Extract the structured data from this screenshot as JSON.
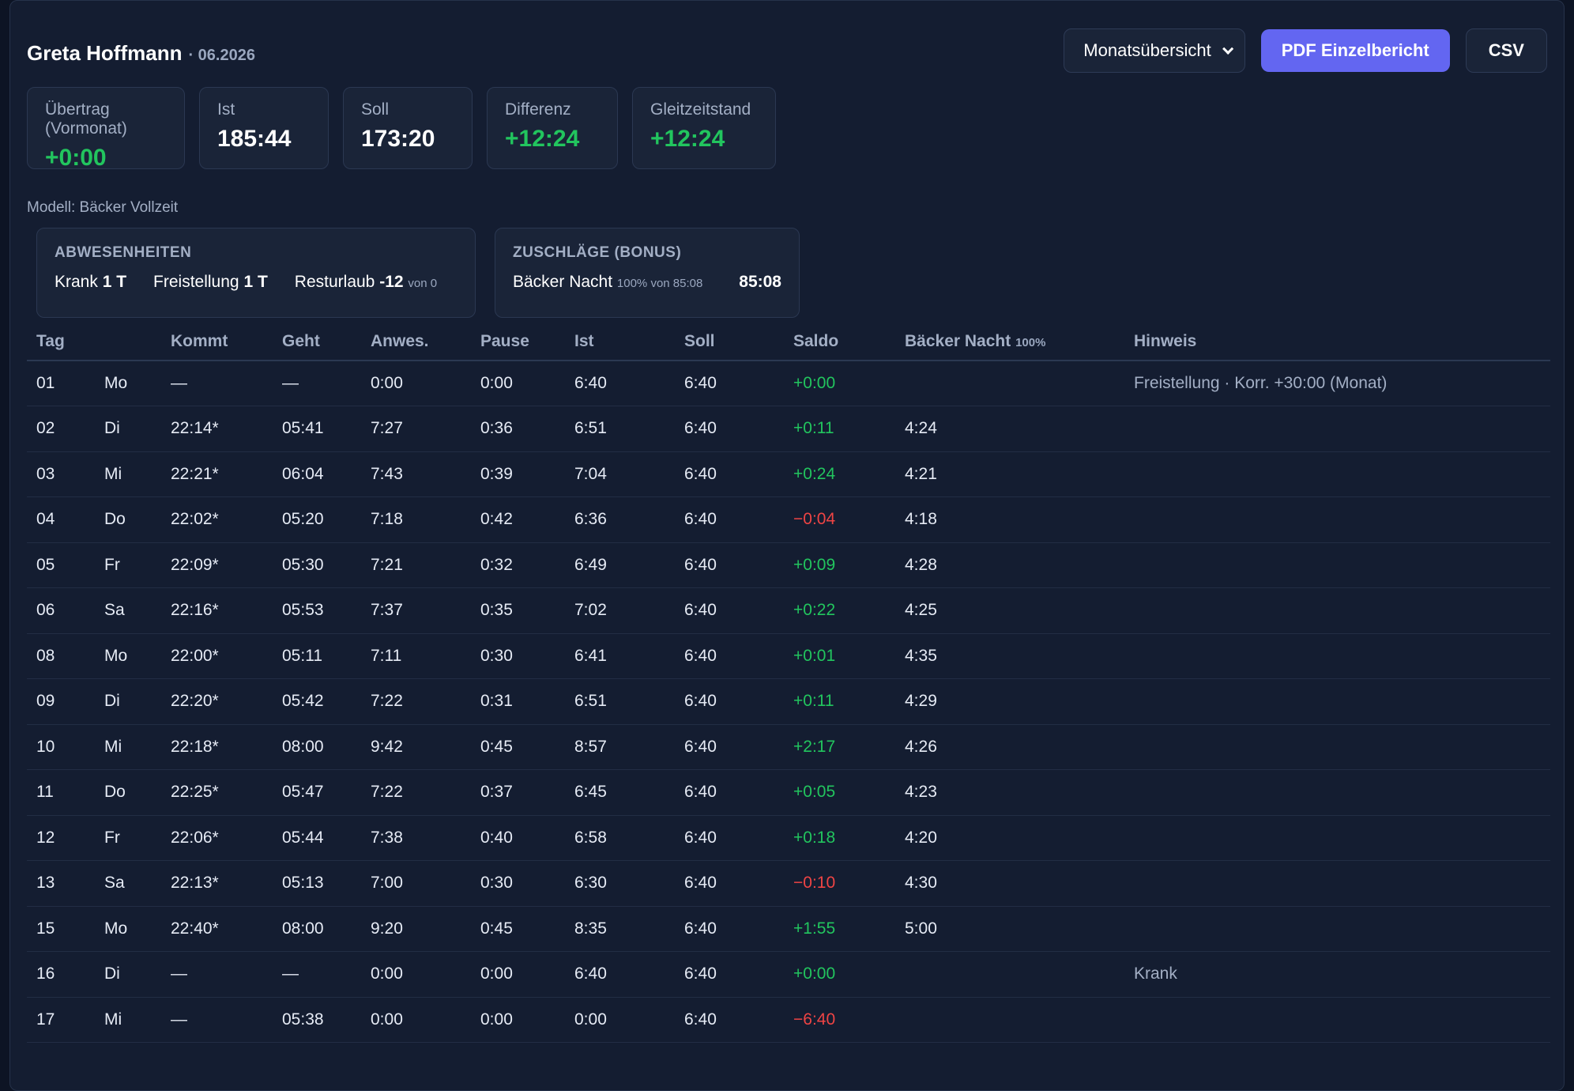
{
  "header": {
    "name": "Greta Hoffmann",
    "period": "· 06.2026"
  },
  "actions": {
    "view_select": "Monatsübersicht",
    "pdf_label": "PDF Einzelbericht",
    "csv_label": "CSV"
  },
  "stats": [
    {
      "label": "Übertrag (Vormonat)",
      "value": "+0:00",
      "tone": "pos"
    },
    {
      "label": "Ist",
      "value": "185:44",
      "tone": ""
    },
    {
      "label": "Soll",
      "value": "173:20",
      "tone": ""
    },
    {
      "label": "Differenz",
      "value": "+12:24",
      "tone": "pos"
    },
    {
      "label": "Gleitzeitstand",
      "value": "+12:24",
      "tone": "pos"
    }
  ],
  "model": "Modell: Bäcker Vollzeit",
  "absences": {
    "title": "ABWESENHEITEN",
    "krank_label": "Krank",
    "krank_value": "1 T",
    "frei_label": "Freistellung",
    "frei_value": "1 T",
    "urlaub_label": "Resturlaub",
    "urlaub_value": "-12",
    "urlaub_note": "von 0"
  },
  "bonus": {
    "title": "ZUSCHLÄGE (BONUS)",
    "label": "Bäcker Nacht",
    "note": "100% von 85:08",
    "value": "85:08"
  },
  "table": {
    "headers": [
      "Tag",
      "",
      "Kommt",
      "Geht",
      "Anwes.",
      "Pause",
      "Ist",
      "Soll",
      "Saldo",
      "Bäcker Nacht",
      "Hinweis"
    ],
    "bonus_header_note": "100%",
    "rows": [
      [
        "01",
        "Mo",
        "—",
        "—",
        "0:00",
        "0:00",
        "6:40",
        "6:40",
        "+0:00",
        "",
        "Freistellung · Korr. +30:00 (Monat)"
      ],
      [
        "02",
        "Di",
        "22:14*",
        "05:41",
        "7:27",
        "0:36",
        "6:51",
        "6:40",
        "+0:11",
        "4:24",
        ""
      ],
      [
        "03",
        "Mi",
        "22:21*",
        "06:04",
        "7:43",
        "0:39",
        "7:04",
        "6:40",
        "+0:24",
        "4:21",
        ""
      ],
      [
        "04",
        "Do",
        "22:02*",
        "05:20",
        "7:18",
        "0:42",
        "6:36",
        "6:40",
        "−0:04",
        "4:18",
        ""
      ],
      [
        "05",
        "Fr",
        "22:09*",
        "05:30",
        "7:21",
        "0:32",
        "6:49",
        "6:40",
        "+0:09",
        "4:28",
        ""
      ],
      [
        "06",
        "Sa",
        "22:16*",
        "05:53",
        "7:37",
        "0:35",
        "7:02",
        "6:40",
        "+0:22",
        "4:25",
        ""
      ],
      [
        "08",
        "Mo",
        "22:00*",
        "05:11",
        "7:11",
        "0:30",
        "6:41",
        "6:40",
        "+0:01",
        "4:35",
        ""
      ],
      [
        "09",
        "Di",
        "22:20*",
        "05:42",
        "7:22",
        "0:31",
        "6:51",
        "6:40",
        "+0:11",
        "4:29",
        ""
      ],
      [
        "10",
        "Mi",
        "22:18*",
        "08:00",
        "9:42",
        "0:45",
        "8:57",
        "6:40",
        "+2:17",
        "4:26",
        ""
      ],
      [
        "11",
        "Do",
        "22:25*",
        "05:47",
        "7:22",
        "0:37",
        "6:45",
        "6:40",
        "+0:05",
        "4:23",
        ""
      ],
      [
        "12",
        "Fr",
        "22:06*",
        "05:44",
        "7:38",
        "0:40",
        "6:58",
        "6:40",
        "+0:18",
        "4:20",
        ""
      ],
      [
        "13",
        "Sa",
        "22:13*",
        "05:13",
        "7:00",
        "0:30",
        "6:30",
        "6:40",
        "−0:10",
        "4:30",
        ""
      ],
      [
        "15",
        "Mo",
        "22:40*",
        "08:00",
        "9:20",
        "0:45",
        "8:35",
        "6:40",
        "+1:55",
        "5:00",
        ""
      ],
      [
        "16",
        "Di",
        "—",
        "—",
        "0:00",
        "0:00",
        "6:40",
        "6:40",
        "+0:00",
        "",
        "Krank"
      ],
      [
        "17",
        "Mi",
        "—",
        "05:38",
        "0:00",
        "0:00",
        "0:00",
        "6:40",
        "−6:40",
        "",
        ""
      ]
    ]
  }
}
